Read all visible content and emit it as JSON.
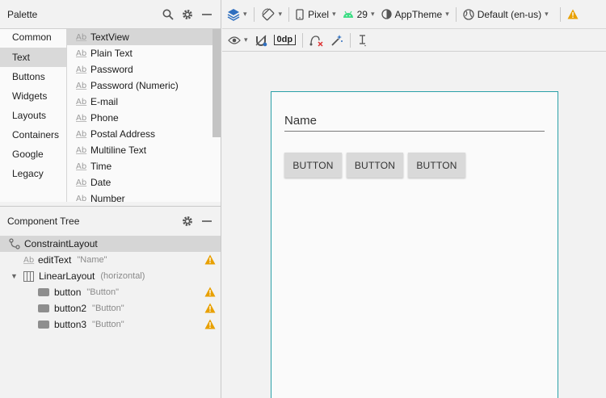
{
  "palette": {
    "title": "Palette",
    "categories": [
      "Common",
      "Text",
      "Buttons",
      "Widgets",
      "Layouts",
      "Containers",
      "Google",
      "Legacy"
    ],
    "selected_category": "Text",
    "items": [
      "TextView",
      "Plain Text",
      "Password",
      "Password (Numeric)",
      "E-mail",
      "Phone",
      "Postal Address",
      "Multiline Text",
      "Time",
      "Date",
      "Number"
    ],
    "selected_item": "TextView",
    "item_prefix": "Ab"
  },
  "component_tree": {
    "title": "Component Tree",
    "root": "ConstraintLayout",
    "edit_text": {
      "name": "editText",
      "value": "\"Name\""
    },
    "linear_layout": {
      "name": "LinearLayout",
      "orientation": "(horizontal)"
    },
    "buttons": [
      {
        "name": "button",
        "value": "\"Button\""
      },
      {
        "name": "button2",
        "value": "\"Button\""
      },
      {
        "name": "button3",
        "value": "\"Button\""
      }
    ]
  },
  "toolbar": {
    "device": "Pixel",
    "api_level": "29",
    "theme": "AppTheme",
    "locale": "Default (en-us)",
    "margin": "0dp"
  },
  "design": {
    "name_field": "Name",
    "buttons": [
      "BUTTON",
      "BUTTON",
      "BUTTON"
    ]
  },
  "colors": {
    "accent": "#2aa0a8",
    "warning": "#e8a000",
    "android_green": "#3ddc84",
    "layers_blue": "#2f6fbf"
  }
}
